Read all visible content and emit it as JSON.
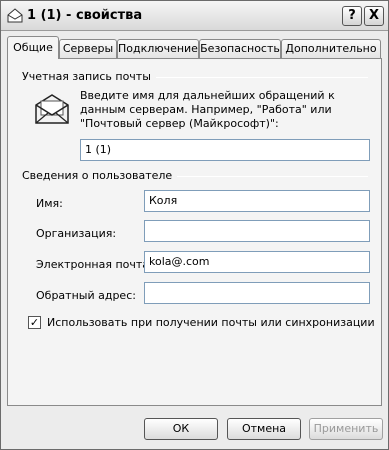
{
  "window": {
    "title": "1 (1) - свойства",
    "help_label": "?",
    "close_label": "X"
  },
  "tabs": [
    {
      "label": "Общие",
      "active": true
    },
    {
      "label": "Серверы",
      "active": false
    },
    {
      "label": "Подключение",
      "active": false
    },
    {
      "label": "Безопасность",
      "active": false
    },
    {
      "label": "Дополнительно",
      "active": false
    }
  ],
  "account": {
    "group_label": "Учетная запись почты",
    "description": "Введите имя для дальнейших обращений к данным серверам. Например, \"Работа\" или \"Почтовый сервер (Майкрософт)\":",
    "name_value": "1 (1)"
  },
  "user": {
    "group_label": "Сведения о пользователе",
    "name_label": "Имя:",
    "name_value": "Коля",
    "org_label": "Организация:",
    "org_value": "",
    "email_label": "Электронная почта:",
    "email_value": "kola@.com",
    "reply_label": "Обратный адрес:",
    "reply_value": ""
  },
  "include_check": {
    "label": "Использовать при получении почты или синхронизации",
    "checked": true,
    "mark": "✓"
  },
  "buttons": {
    "ok": "ОК",
    "cancel": "Отмена",
    "apply": "Применить"
  }
}
